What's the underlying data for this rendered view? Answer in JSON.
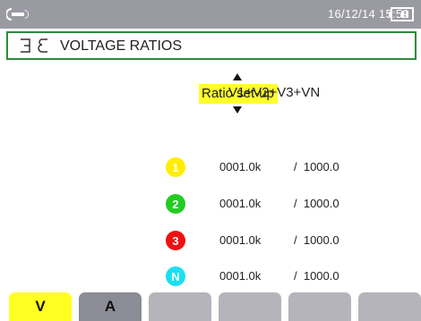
{
  "status": {
    "datetime": "16/12/14 15:59",
    "tools_icon": "wrench-icon",
    "battery_icon": "battery-icon"
  },
  "header": {
    "icon": "transformer-icon",
    "title": "VOLTAGE RATIOS"
  },
  "setup": {
    "label": "Ratio set-up",
    "channels": "V1+V2+V3+VN"
  },
  "rows": [
    {
      "phase": "1",
      "color": "#ffee00",
      "primary": "0001.0k",
      "secondary": "/  1000.0"
    },
    {
      "phase": "2",
      "color": "#22cc22",
      "primary": "0001.0k",
      "secondary": "/  1000.0"
    },
    {
      "phase": "3",
      "color": "#ee1111",
      "primary": "0001.0k",
      "secondary": "/  1000.0"
    },
    {
      "phase": "N",
      "color": "#19e0f0",
      "primary": "0001.0k",
      "secondary": "/  1000.0"
    }
  ],
  "tabs": [
    {
      "label": "V",
      "color": "#ffff22",
      "active": true
    },
    {
      "label": "A",
      "color": "#8c8c96",
      "active": false
    },
    {
      "label": "",
      "color": "#b4b4ba",
      "active": false
    },
    {
      "label": "",
      "color": "#b4b4ba",
      "active": false
    },
    {
      "label": "",
      "color": "#b4b4ba",
      "active": false
    },
    {
      "label": "",
      "color": "#b4b4ba",
      "active": false
    }
  ]
}
